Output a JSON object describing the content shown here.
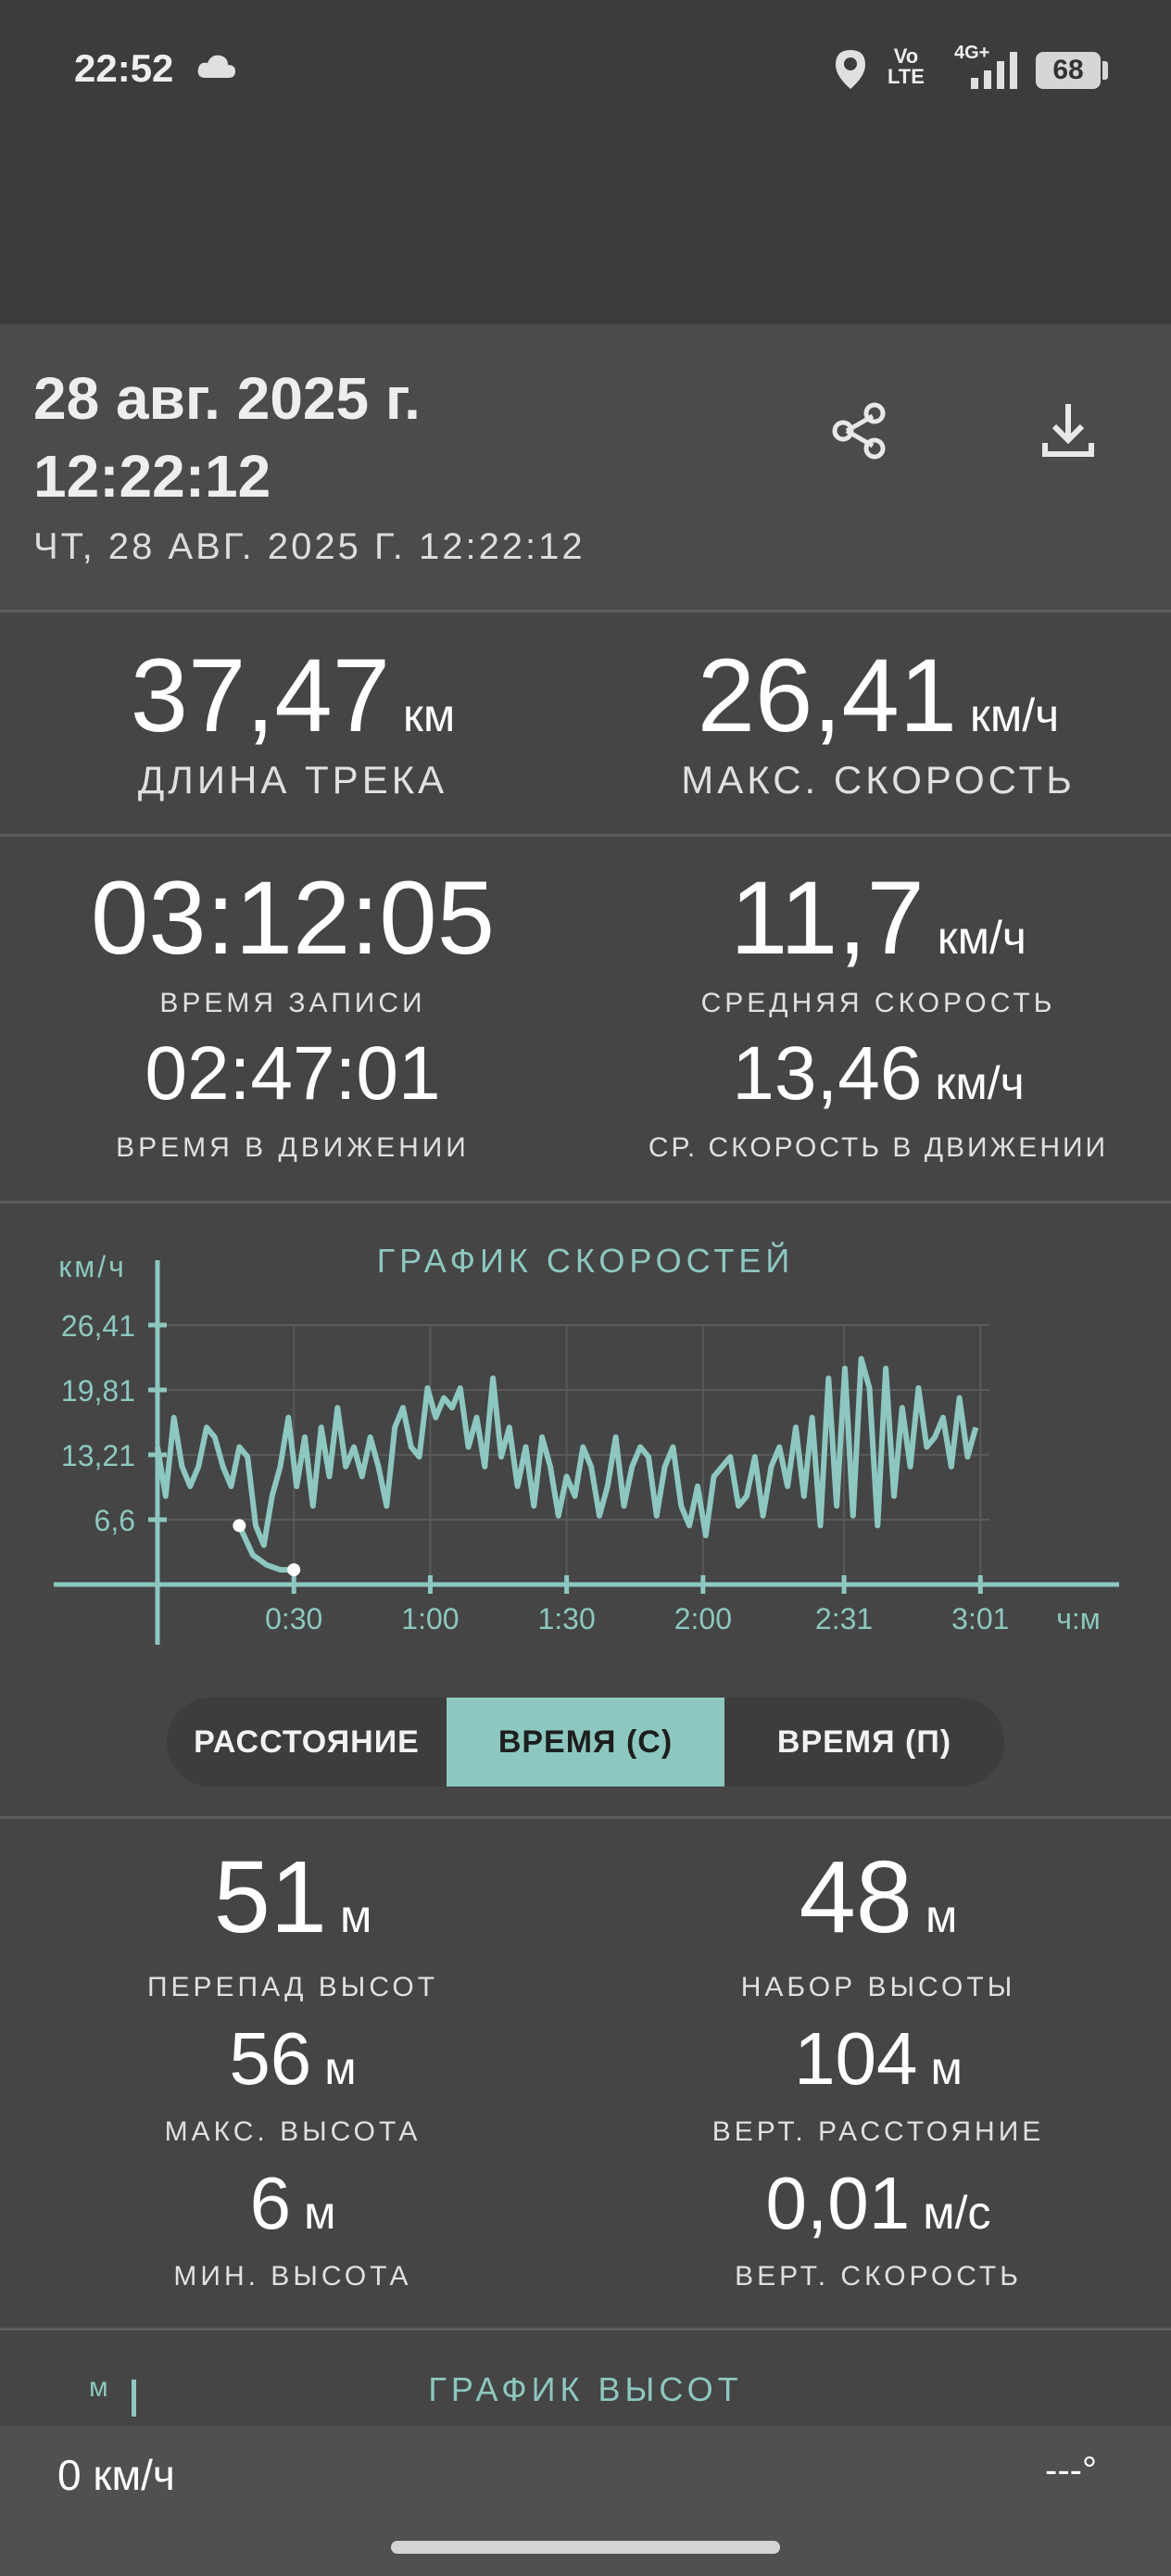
{
  "status": {
    "time": "22:52",
    "volte_top": "Vo",
    "volte_bottom": "LTE",
    "network": "4G+",
    "battery": "68"
  },
  "header": {
    "title": "28 авг. 2025 г. 12:22:12",
    "subtitle": "ЧТ, 28 АВГ. 2025 Г. 12:22:12"
  },
  "stats": {
    "distance": {
      "value": "37,47",
      "unit": "км",
      "label": "ДЛИНА ТРЕКА"
    },
    "max_speed": {
      "value": "26,41",
      "unit": "км/ч",
      "label": "МАКС. СКОРОСТЬ"
    },
    "record_time": {
      "value": "03:12:05",
      "label": "ВРЕМЯ ЗАПИСИ"
    },
    "avg_speed": {
      "value": "11,7",
      "unit": "км/ч",
      "label": "СРЕДНЯЯ СКОРОСТЬ"
    },
    "moving_time": {
      "value": "02:47:01",
      "label": "ВРЕМЯ В ДВИЖЕНИИ"
    },
    "avg_moving_speed": {
      "value": "13,46",
      "unit": "км/ч",
      "label": "СР. СКОРОСТЬ В ДВИЖЕНИИ"
    }
  },
  "chart_data": {
    "type": "line",
    "title": "ГРАФИК СКОРОСТЕЙ",
    "ylabel": "км/ч",
    "xlabel": "ч:м",
    "ylim": [
      0,
      26.41
    ],
    "xlim": [
      0,
      3.05
    ],
    "y_ticks": [
      "26,41",
      "19,81",
      "13,21",
      "6,6"
    ],
    "y_tick_values": [
      26.41,
      19.81,
      13.21,
      6.6
    ],
    "x_ticks": [
      "0:30",
      "1:00",
      "1:30",
      "2:00",
      "2:31",
      "3:01"
    ],
    "x_tick_values": [
      0.5,
      1.0,
      1.5,
      2.0,
      2.517,
      3.017
    ],
    "grid": true,
    "series": [
      {
        "values_x": [
          0.0,
          0.03,
          0.06,
          0.09,
          0.12,
          0.15,
          0.18,
          0.21,
          0.24,
          0.27,
          0.3,
          0.33,
          0.36,
          0.39,
          0.42,
          0.45,
          0.48,
          0.51,
          0.54,
          0.57,
          0.6,
          0.63,
          0.66,
          0.69,
          0.72,
          0.75,
          0.78,
          0.81,
          0.84,
          0.87,
          0.9,
          0.93,
          0.96,
          0.99,
          1.02,
          1.05,
          1.08,
          1.11,
          1.14,
          1.17,
          1.2,
          1.23,
          1.26,
          1.29,
          1.32,
          1.35,
          1.38,
          1.41,
          1.44,
          1.47,
          1.5,
          1.53,
          1.56,
          1.59,
          1.62,
          1.65,
          1.68,
          1.71,
          1.74,
          1.77,
          1.8,
          1.83,
          1.86,
          1.89,
          1.92,
          1.95,
          1.98,
          2.01,
          2.04,
          2.07,
          2.1,
          2.13,
          2.16,
          2.19,
          2.22,
          2.25,
          2.28,
          2.31,
          2.34,
          2.37,
          2.4,
          2.43,
          2.46,
          2.49,
          2.52,
          2.55,
          2.58,
          2.61,
          2.64,
          2.67,
          2.7,
          2.73,
          2.76,
          2.79,
          2.82,
          2.85,
          2.88,
          2.91,
          2.94,
          2.97,
          3.0
        ],
        "values_y": [
          14,
          9,
          17,
          12,
          10,
          12,
          16,
          15,
          12,
          10,
          14,
          13,
          6,
          4,
          9,
          12,
          17,
          10,
          15,
          8,
          16,
          11,
          18,
          12,
          14,
          11,
          15,
          12,
          8,
          16,
          18,
          14,
          13,
          20,
          17,
          19,
          18,
          20,
          14,
          17,
          12,
          21,
          13,
          16,
          10,
          14,
          8,
          15,
          12,
          7,
          11,
          9,
          14,
          12,
          7,
          10,
          15,
          8,
          12,
          14,
          13,
          7,
          12,
          14,
          8,
          6,
          10,
          5,
          11,
          12,
          13,
          8,
          9,
          13,
          7,
          12,
          14,
          10,
          16,
          9,
          17,
          6,
          21,
          8,
          22,
          7,
          23,
          20,
          6,
          22,
          9,
          18,
          12,
          20,
          14,
          15,
          17,
          12,
          19,
          13,
          16
        ]
      },
      {
        "values_x": [
          0.3,
          0.35,
          0.4,
          0.45,
          0.5
        ],
        "values_y": [
          6,
          3,
          2,
          1.5,
          1.5
        ]
      }
    ]
  },
  "segments": {
    "distance": "РАССТОЯНИЕ",
    "time_c": "ВРЕМЯ (С)",
    "time_p": "ВРЕМЯ (П)"
  },
  "altitude": {
    "diff": {
      "value": "51",
      "unit": "м",
      "label": "ПЕРЕПАД ВЫСОТ"
    },
    "gain": {
      "value": "48",
      "unit": "м",
      "label": "НАБОР ВЫСОТЫ"
    },
    "max": {
      "value": "56",
      "unit": "м",
      "label": "МАКС. ВЫСОТА"
    },
    "vert_distance": {
      "value": "104",
      "unit": "м",
      "label": "ВЕРТ. РАССТОЯНИЕ"
    },
    "min": {
      "value": "6",
      "unit": "м",
      "label": "МИН. ВЫСОТА"
    },
    "vert_speed": {
      "value": "0,01",
      "unit": "м/с",
      "label": "ВЕРТ. СКОРОСТЬ"
    },
    "chart_title": "ГРАФИК ВЫСОТ",
    "chart_unit": "м"
  },
  "bottom": {
    "current_speed": "0 км/ч",
    "bearing": "---°"
  },
  "colors": {
    "accent": "#8cc8bf",
    "background": "#454545"
  }
}
